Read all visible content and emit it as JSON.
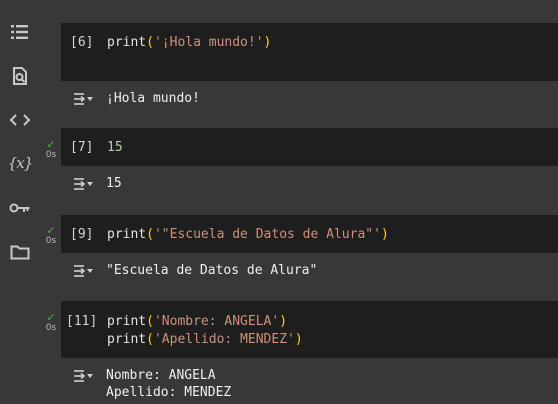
{
  "sidebar": {
    "icons": [
      "table-of-contents-icon",
      "find-icon",
      "code-snippets-icon",
      "variables-icon",
      "secrets-key-icon",
      "files-folder-icon"
    ],
    "variables_glyph": "{x}"
  },
  "cells": [
    {
      "count": "[6]",
      "status": "",
      "code": {
        "fn": "print",
        "open": "(",
        "str": "'¡Hola mundo!'",
        "close": ")"
      },
      "output": "¡Hola mundo!"
    },
    {
      "count": "[7]",
      "status": "0s",
      "code": {
        "num": "15"
      },
      "output": "15"
    },
    {
      "count": "[9]",
      "status": "0s",
      "code": {
        "fn": "print",
        "open": "(",
        "str": "'\"Escuela de Datos de Alura\"'",
        "close": ")"
      },
      "output": "\"Escuela de Datos de Alura\""
    },
    {
      "count": "[11]",
      "status": "0s",
      "code_lines": [
        {
          "fn": "print",
          "open": "(",
          "str": "'Nombre: ANGELA'",
          "close": ")"
        },
        {
          "fn": "print",
          "open": "(",
          "str": "'Apellido: MENDEZ'",
          "close": ")"
        }
      ],
      "output_lines": [
        "Nombre: ANGELA",
        "Apellido: MENDEZ"
      ]
    }
  ],
  "colors": {
    "background": "#383838",
    "code_background": "#1e1e1e",
    "string": "#ce9178",
    "number": "#b5cea8",
    "paren": "#ffd700",
    "success_check": "#4caf50"
  }
}
